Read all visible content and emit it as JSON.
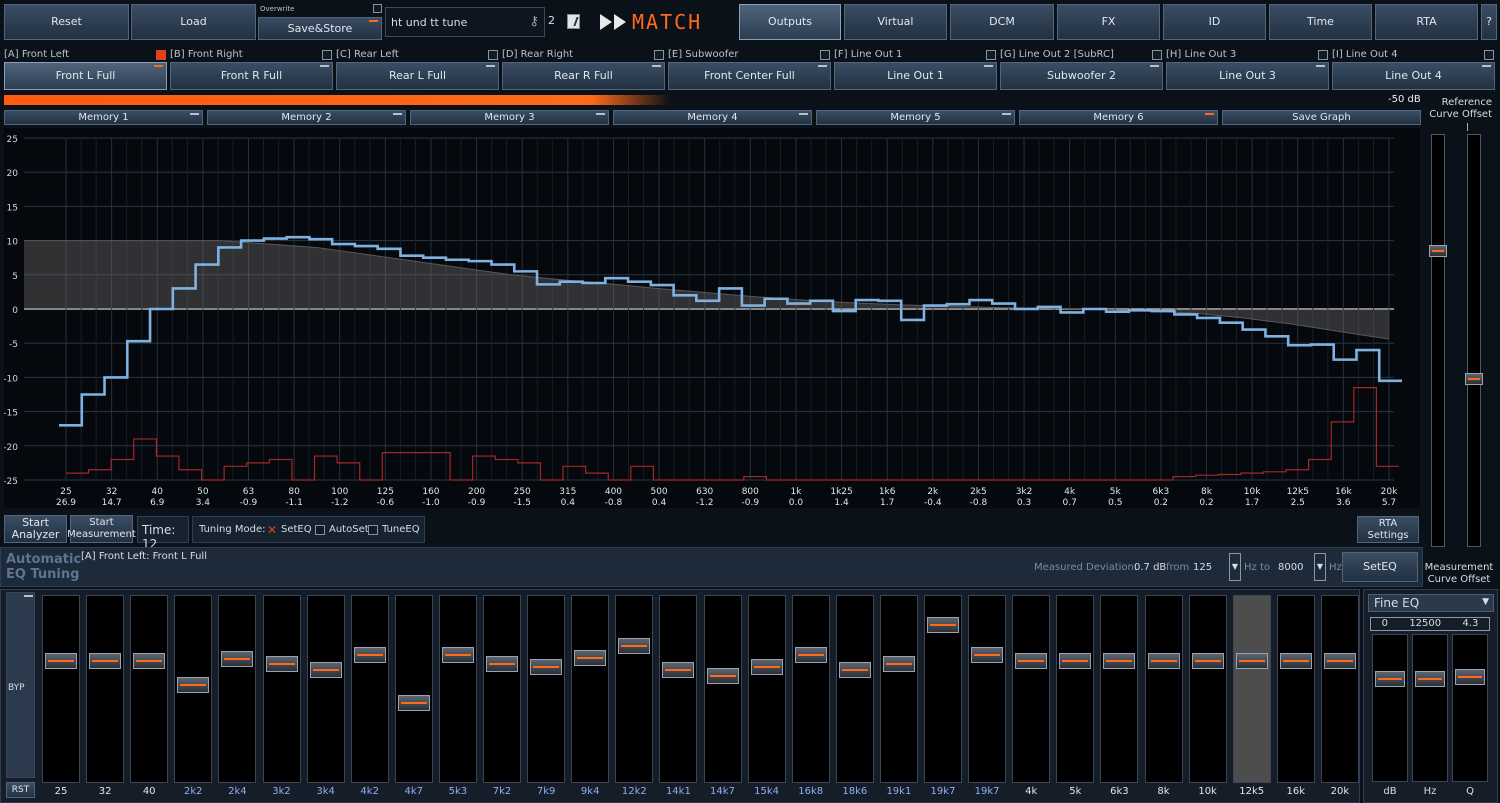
{
  "toolbar": {
    "reset": "Reset",
    "load": "Load",
    "overwrite": "Overwrite",
    "save_store": "Save&Store",
    "preset_name": "ht und tt tune",
    "preset_num": "2",
    "logo": "MATCH",
    "tabs": [
      "Outputs",
      "Virtual",
      "DCM",
      "FX",
      "ID",
      "Time",
      "RTA",
      "?"
    ]
  },
  "channels": [
    {
      "header": "[A] Front Left",
      "name": "Front L Full",
      "checked": true
    },
    {
      "header": "[B] Front Right",
      "name": "Front R Full",
      "checked": false
    },
    {
      "header": "[C] Rear Left",
      "name": "Rear L Full",
      "checked": false
    },
    {
      "header": "[D] Rear Right",
      "name": "Rear R Full",
      "checked": false
    },
    {
      "header": "[E] Subwoofer",
      "name": "Front Center Full",
      "checked": false
    },
    {
      "header": "[F] Line Out 1",
      "name": "Line Out 1",
      "checked": false
    },
    {
      "header": "[G] Line Out 2 [SubRC]",
      "name": "Subwoofer 2",
      "checked": false
    },
    {
      "header": "[H] Line Out 3",
      "name": "Line Out 3",
      "checked": false
    },
    {
      "header": "[I] Line Out 4",
      "name": "Line Out 4",
      "checked": false
    }
  ],
  "level": {
    "text": "-50 dB",
    "fraction": 0.47
  },
  "memory": [
    "Memory 1",
    "Memory 2",
    "Memory 3",
    "Memory 4",
    "Memory 5",
    "Memory 6",
    "Save Graph"
  ],
  "reference": {
    "title": "Reference\nCurve Offset",
    "measure": "Measurement\nCurve Offset",
    "ref_value": 11,
    "meas_value": -4.5
  },
  "chart_data": {
    "type": "line",
    "ylim": [
      -25,
      25
    ],
    "yticks": [
      25,
      20,
      15,
      10,
      5,
      0,
      -5,
      -10,
      -15,
      -20,
      -25
    ],
    "bands": [
      "25",
      "32",
      "40",
      "50",
      "63",
      "80",
      "100",
      "125",
      "160",
      "200",
      "250",
      "315",
      "400",
      "500",
      "630",
      "800",
      "1k",
      "1k25",
      "1k6",
      "2k",
      "2k5",
      "3k2",
      "4k",
      "5k",
      "6k3",
      "8k",
      "10k",
      "12k5",
      "16k",
      "20k"
    ],
    "band_values": [
      "26.9",
      "14.7",
      "6.9",
      "3.4",
      "-0.9",
      "-1.1",
      "-1.2",
      "-0.6",
      "-1.0",
      "-0.9",
      "-1.5",
      "0.4",
      "-0.8",
      "0.4",
      "-1.2",
      "-0.9",
      "0.0",
      "1.4",
      "1.7",
      "-0.4",
      "-0.8",
      "0.3",
      "0.7",
      "0.5",
      "0.2",
      "0.2",
      "1.7",
      "2.5",
      "3.6",
      "5.7"
    ],
    "measurement": [
      -17,
      -12.5,
      -10,
      -4.7,
      0,
      3,
      6.5,
      9,
      10,
      10.3,
      10.5,
      10.2,
      9.5,
      9.2,
      8.8,
      7.8,
      7.5,
      7.2,
      7,
      6.5,
      5.5,
      3.6,
      4,
      3.8,
      4.5,
      4,
      3.5,
      2,
      1.2,
      3,
      0.5,
      1.5,
      0.8,
      1.2,
      -0.3,
      1.3,
      1.2,
      -1.6,
      0.5,
      0.7,
      1.3,
      0.8,
      0,
      0.3,
      -0.5,
      0,
      -0.4,
      -0.2,
      -0.3,
      -0.8,
      -1.3,
      -2,
      -3,
      -4,
      -5.3,
      -5.2,
      -7.4,
      -6,
      -10.5
    ],
    "reference": [
      10,
      10,
      10,
      10,
      10,
      9.5,
      9,
      8,
      7,
      6,
      5,
      4.3,
      3.7,
      3,
      2.4,
      1.8,
      1.3,
      0.9,
      0.6,
      0.4,
      0.2,
      0.1,
      0,
      -0.3,
      -0.6,
      -1.3,
      -2.2,
      -3.3,
      -4.4
    ],
    "rta": [
      -24,
      -23.5,
      -22,
      -19,
      -21.5,
      -23.5,
      -25,
      -23,
      -22.5,
      -22,
      -25,
      -21.5,
      -22.5,
      -25,
      -21,
      -21,
      -21,
      -25,
      -21.5,
      -22,
      -22.5,
      -25,
      -23,
      -24,
      -25,
      -23,
      -25,
      -25,
      -25,
      -25,
      -24.5,
      -25,
      -25,
      -25,
      -25,
      -25,
      -25,
      -25,
      -25,
      -25,
      -25,
      -25,
      -25,
      -25,
      -25,
      -25,
      -25,
      -25,
      -25,
      -24.5,
      -24.3,
      -24.2,
      -24,
      -23.8,
      -23.5,
      -22,
      -16.5,
      -11.5,
      -23
    ]
  },
  "analyzer": {
    "start_analyzer": "Start\nAnalyzer",
    "start_measurement": "Start\nMeasurement",
    "time": "Time: 12",
    "tuning_mode": "Tuning Mode:",
    "modes": [
      "SetEQ",
      "AutoSet",
      "TuneEQ"
    ],
    "rta_settings": "RTA Settings"
  },
  "auto_eq": {
    "title": "Automatic\nEQ Tuning",
    "channel": "[A] Front Left: Front L Full",
    "measured_deviation": "Measured  Deviation:",
    "deviation": "0.7 dB",
    "from": "from",
    "from_value": "125",
    "hz_to": "Hz  to",
    "to_value": "8000",
    "hz": "Hz",
    "set_eq": "SetEQ"
  },
  "eq": {
    "byp": "BYP",
    "rst": "RST",
    "bands": [
      {
        "label": "25",
        "db": 0,
        "hl": false
      },
      {
        "label": "32",
        "db": 0,
        "hl": false
      },
      {
        "label": "40",
        "db": 0,
        "hl": false
      },
      {
        "label": "2k2",
        "db": -4,
        "hl": true
      },
      {
        "label": "2k4",
        "db": 0.4,
        "hl": true
      },
      {
        "label": "3k2",
        "db": -0.5,
        "hl": true
      },
      {
        "label": "3k4",
        "db": -1.5,
        "hl": true
      },
      {
        "label": "4k2",
        "db": 1,
        "hl": true
      },
      {
        "label": "4k7",
        "db": -7,
        "hl": true
      },
      {
        "label": "5k3",
        "db": 1,
        "hl": true
      },
      {
        "label": "7k2",
        "db": -0.5,
        "hl": true
      },
      {
        "label": "7k9",
        "db": -1,
        "hl": true
      },
      {
        "label": "9k4",
        "db": 0.5,
        "hl": true
      },
      {
        "label": "12k2",
        "db": 2.5,
        "hl": true
      },
      {
        "label": "14k1",
        "db": -1.5,
        "hl": true
      },
      {
        "label": "14k7",
        "db": -2.5,
        "hl": true
      },
      {
        "label": "15k4",
        "db": -1,
        "hl": true
      },
      {
        "label": "16k8",
        "db": 1,
        "hl": true
      },
      {
        "label": "18k6",
        "db": -1.5,
        "hl": true
      },
      {
        "label": "19k1",
        "db": -0.5,
        "hl": true
      },
      {
        "label": "19k7",
        "db": 6,
        "hl": true
      },
      {
        "label": "19k7",
        "db": 1,
        "hl": true
      },
      {
        "label": "4k",
        "db": 0,
        "hl": false
      },
      {
        "label": "5k",
        "db": 0,
        "hl": false
      },
      {
        "label": "6k3",
        "db": 0,
        "hl": false
      },
      {
        "label": "8k",
        "db": 0,
        "hl": false
      },
      {
        "label": "10k",
        "db": 0,
        "hl": false
      },
      {
        "label": "12k5",
        "db": 0,
        "hl": false,
        "selected": true
      },
      {
        "label": "16k",
        "db": 0,
        "hl": false
      },
      {
        "label": "20k",
        "db": 0,
        "hl": false
      }
    ]
  },
  "fine_eq": {
    "title": "Fine EQ",
    "values": [
      "0",
      "12500",
      "4.3"
    ],
    "labels": [
      "dB",
      "Hz",
      "Q"
    ]
  },
  "colors": {
    "accent": "#ff6a1a",
    "measurement": "#7fb2e0",
    "rta": "#a42727",
    "highlight_label": "#8fb0f0"
  }
}
